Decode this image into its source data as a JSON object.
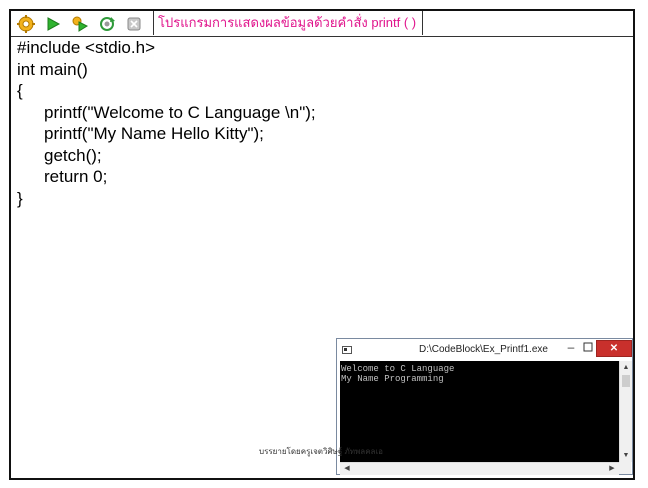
{
  "slide": {
    "title": "โปรแกรมการแสดงผลข้อมูลด้วยคำสั่ง printf ( )",
    "caption": "บรรยายโดยครูเจตวิศิษฐ์ ภัทพลคลเอ"
  },
  "toolbar": {
    "icons": [
      "gear-icon",
      "play-icon",
      "build-run-icon",
      "rebuild-icon",
      "abort-icon"
    ]
  },
  "code": {
    "lines": [
      "#include <stdio.h>",
      "int main()",
      "{",
      "printf(\"Welcome to C Language \\n\");",
      "printf(\"My Name Hello Kitty\");",
      "getch();",
      "return 0;",
      "}"
    ]
  },
  "console": {
    "title": "D:\\CodeBlock\\Ex_Printf1.exe",
    "min_label": "–",
    "close_label": "✕",
    "output": [
      "Welcome to C Language",
      "My Name Programming"
    ]
  },
  "colors": {
    "title": "#e0148c",
    "close_button": "#c9302c",
    "console_bg": "#000000",
    "console_text": "#c0c0c0"
  }
}
